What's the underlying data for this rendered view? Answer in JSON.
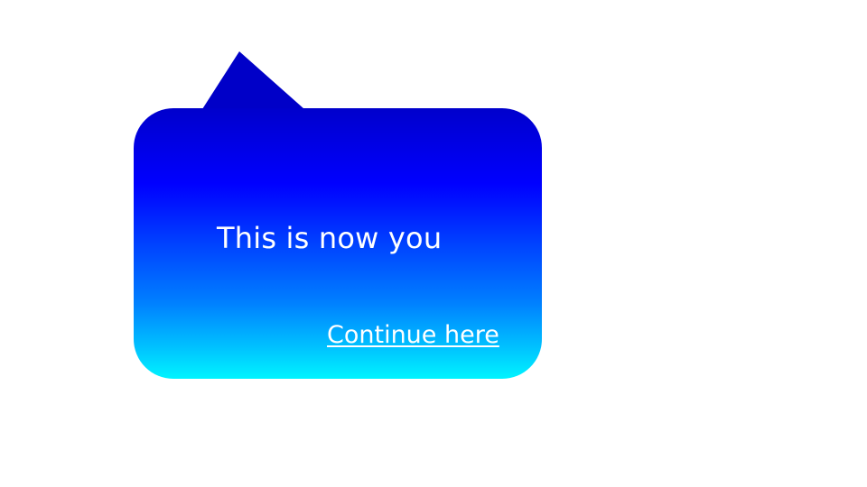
{
  "popup": {
    "message": "This is now you",
    "link_label": "Continue here"
  },
  "colors": {
    "gradient_top": "#0000cc",
    "gradient_mid": "#0000ff",
    "gradient_bottom": "#00f4ff",
    "tail": "#0000c8",
    "text": "#ffffff",
    "background": "#ffffff"
  }
}
